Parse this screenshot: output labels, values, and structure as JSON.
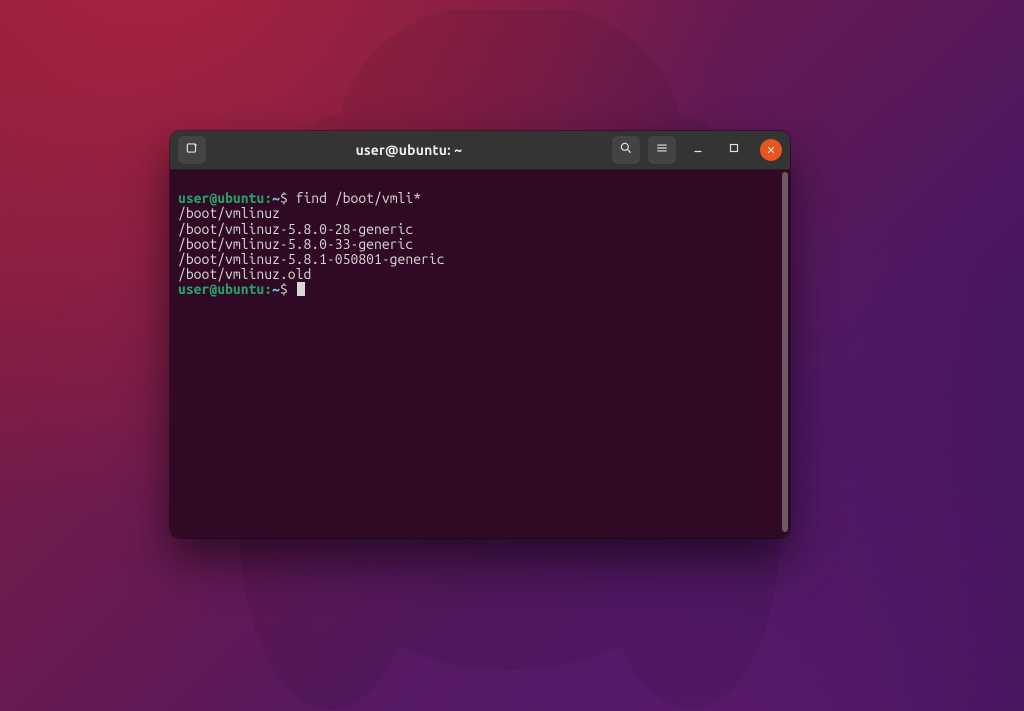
{
  "window": {
    "title": "user@ubuntu: ~"
  },
  "titlebar_icons": {
    "new_tab": "new-tab-icon",
    "search": "search-icon",
    "menu": "hamburger-icon",
    "minimize": "minimize-icon",
    "maximize": "maximize-icon",
    "close": "close-icon"
  },
  "prompt": {
    "userhost": "user@ubuntu",
    "sep": ":",
    "path": "~",
    "symbol": "$"
  },
  "session": {
    "command1": "find /boot/vmli*",
    "output": [
      "/boot/vmlinuz",
      "/boot/vmlinuz-5.8.0-28-generic",
      "/boot/vmlinuz-5.8.0-33-generic",
      "/boot/vmlinuz-5.8.1-050801-generic",
      "/boot/vmlinuz.old"
    ]
  },
  "colors": {
    "term_bg": "#300a24",
    "titlebar_bg": "#343434",
    "accent": "#e95420",
    "prompt_green": "#26a269",
    "prompt_blue": "#7db9df"
  }
}
